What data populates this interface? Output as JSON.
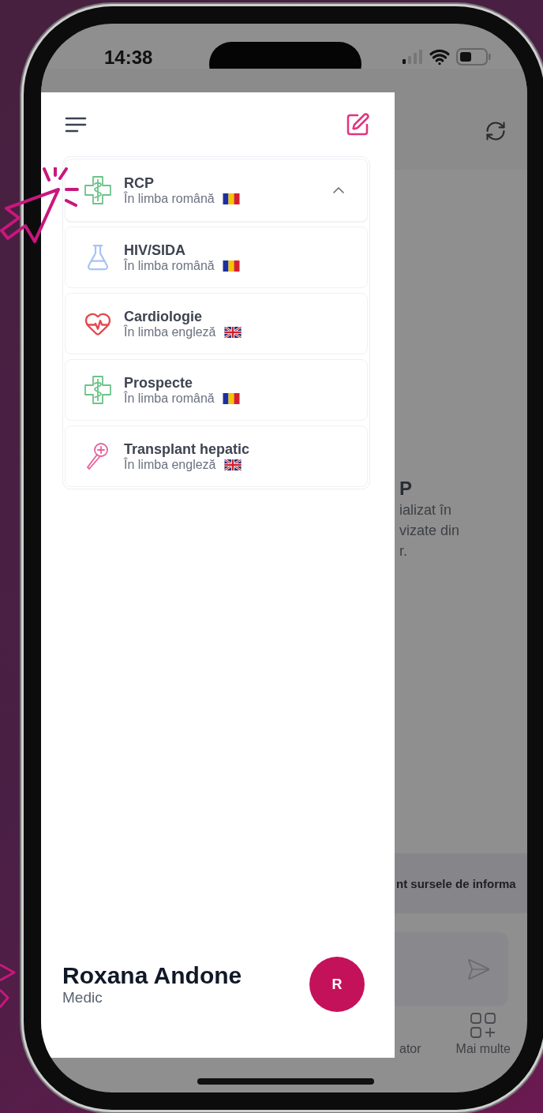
{
  "status_bar": {
    "time": "14:38"
  },
  "drawer": {
    "sections": [
      {
        "title": "RCP",
        "subtitle": "În limba română",
        "flag": {
          "kind": "ro"
        },
        "kind": "caduceus",
        "expanded": true,
        "children": [
          {
            "title": "HIV/SIDA",
            "subtitle": "În limba română",
            "flag": {
              "kind": "ro"
            },
            "kind": "flask"
          },
          {
            "title": "Cardiologie",
            "subtitle": "În limba engleză",
            "flag": {
              "kind": "en"
            },
            "kind": "heart"
          },
          {
            "title": "Prospecte",
            "subtitle": "În limba română",
            "flag": {
              "kind": "ro"
            },
            "kind": "caduceus"
          },
          {
            "title": "Transplant hepatic",
            "subtitle": "În limba engleză",
            "flag": {
              "kind": "en"
            },
            "kind": "probe"
          }
        ]
      }
    ]
  },
  "user": {
    "name": "Roxana Andone",
    "role": "Medic",
    "initial": "R"
  },
  "background_content": {
    "title_fragment": "P",
    "text_lines": [
      "ializat în",
      "vizate din",
      "r."
    ],
    "banner": "nt sursele de informa",
    "nav": [
      {
        "label": "ator",
        "kind": "text"
      },
      {
        "label": "Mai multe",
        "kind": "grid"
      }
    ]
  }
}
